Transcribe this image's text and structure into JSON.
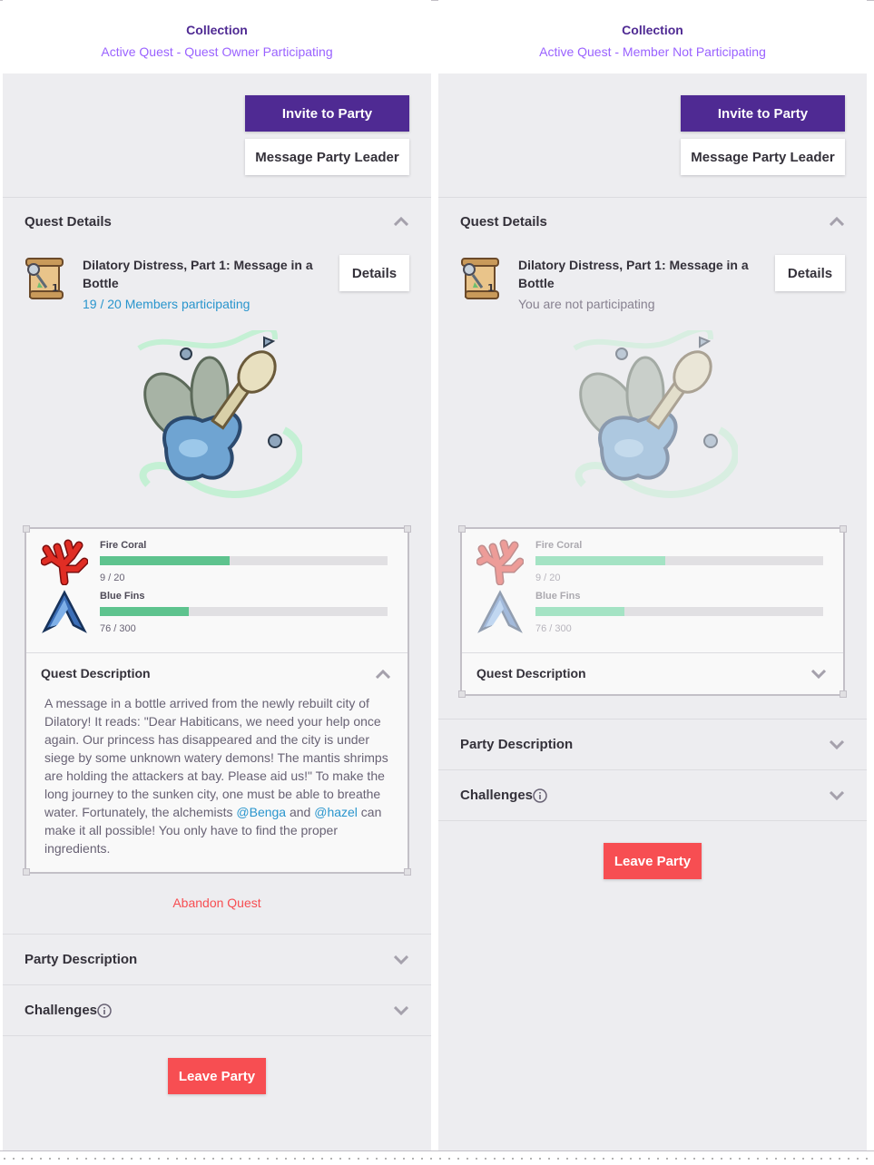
{
  "left": {
    "header_title": "Collection",
    "header_subtitle": "Active Quest - Quest Owner Participating",
    "invite_label": "Invite to Party",
    "message_label": "Message Party Leader",
    "quest_details_title": "Quest Details",
    "quest_name": "Dilatory Distress, Part 1: Message in a Bottle",
    "quest_status": "19 / 20 Members participating",
    "details_label": "Details",
    "items": [
      {
        "name": "Fire Coral",
        "count": "9 / 20",
        "progress": 0.45
      },
      {
        "name": "Blue Fins",
        "count": "76 / 300",
        "progress": 0.31
      }
    ],
    "quest_description_title": "Quest Description",
    "desc_part1": "A message in a bottle arrived from the newly rebuilt city of Dilatory! It reads: \"Dear Habiticans, we need your help once again. Our princess has disappeared and the city is under siege by some unknown watery demons! The mantis shrimps are holding the attackers at bay. Please aid us!\" To make the long journey to the sunken city, one must be able to breathe water. Fortunately, the alchemists ",
    "mention1": "@Benga",
    "desc_part2": " and ",
    "mention2": "@hazel",
    "desc_part3": " can make it all possible! You only have to find the proper ingredients.",
    "abandon_label": "Abandon Quest",
    "party_description_title": "Party Description",
    "challenges_title": "Challenges",
    "leave_label": "Leave Party"
  },
  "right": {
    "header_title": "Collection",
    "header_subtitle": "Active Quest - Member Not Participating",
    "invite_label": "Invite to Party",
    "message_label": "Message Party Leader",
    "quest_details_title": "Quest Details",
    "quest_name": "Dilatory Distress, Part 1: Message in a Bottle",
    "quest_status": "You are not participating",
    "details_label": "Details",
    "items": [
      {
        "name": "Fire Coral",
        "count": "9 / 20",
        "progress": 0.45
      },
      {
        "name": "Blue Fins",
        "count": "76 / 300",
        "progress": 0.31
      }
    ],
    "quest_description_title": "Quest Description",
    "party_description_title": "Party Description",
    "challenges_title": "Challenges",
    "leave_label": "Leave Party"
  },
  "colors": {
    "brand_purple": "#4f2a93",
    "subtitle_purple": "#9a62ff",
    "progress_green": "#5ec38e",
    "danger_red": "#f74e52",
    "mention_blue": "#2995cd"
  },
  "icons": [
    "quest-scroll-icon",
    "fire-coral-icon",
    "blue-fins-icon",
    "chevron-up-icon",
    "chevron-down-icon",
    "info-icon"
  ]
}
